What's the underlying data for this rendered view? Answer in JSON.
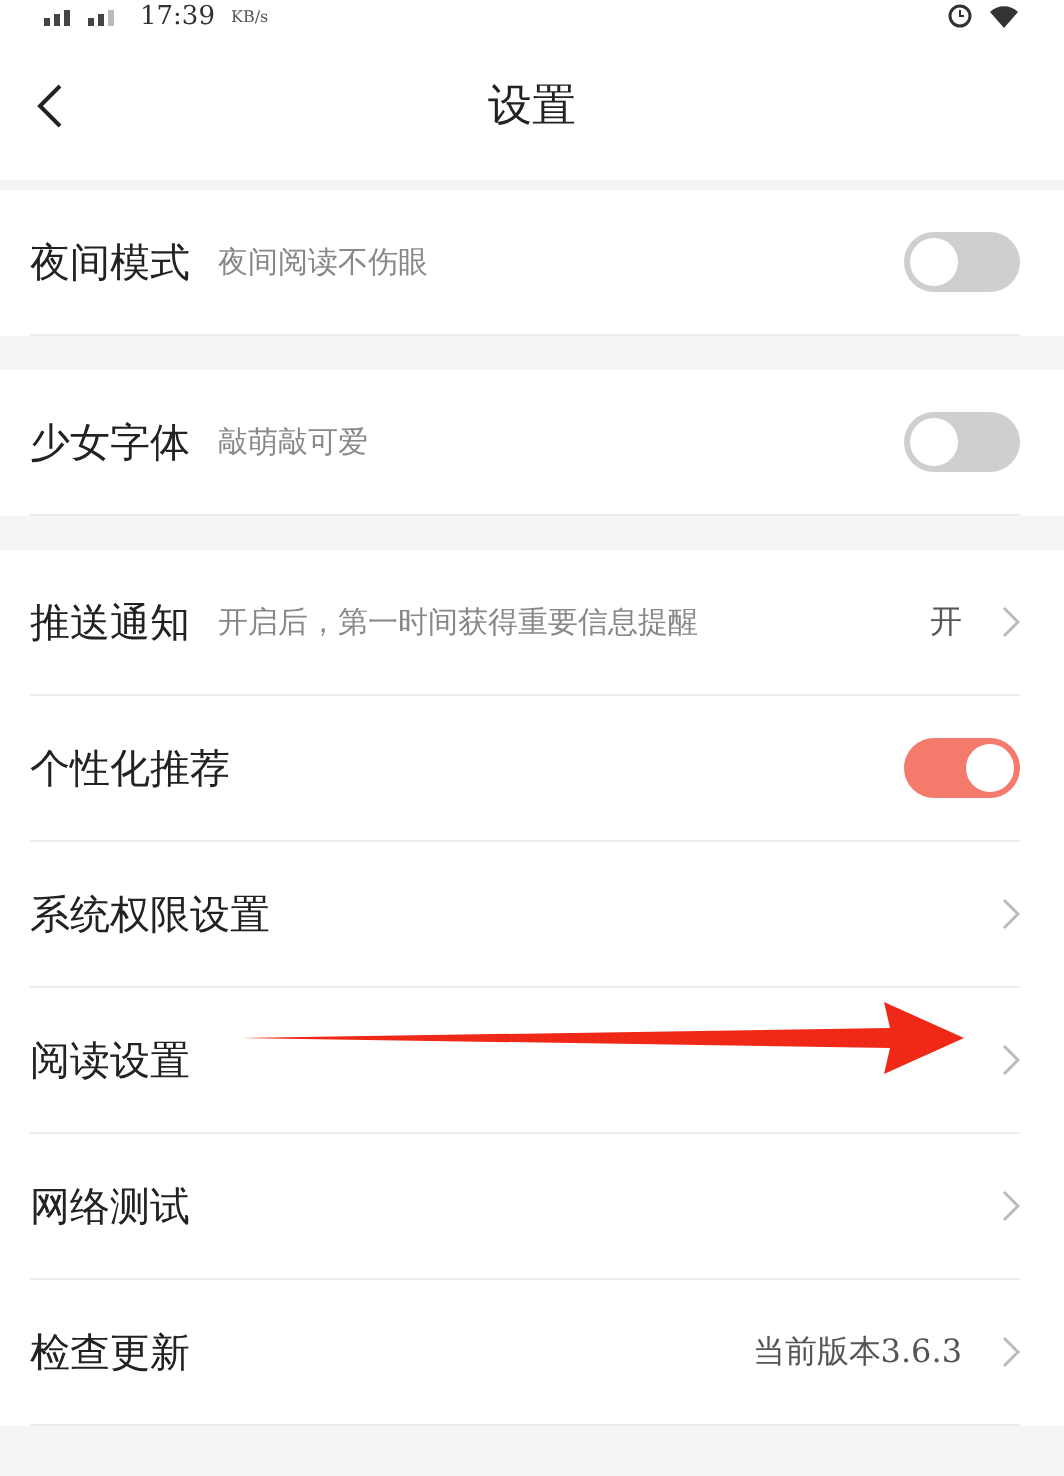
{
  "status_bar": {
    "time": "17:39",
    "speed_unit": "KB/s"
  },
  "header": {
    "title": "设置"
  },
  "groups": [
    {
      "items": [
        {
          "kind": "toggle",
          "label": "夜间模式",
          "subtitle": "夜间阅读不伤眼",
          "on": false
        }
      ]
    },
    {
      "items": [
        {
          "kind": "toggle",
          "label": "少女字体",
          "subtitle": "敲萌敲可爱",
          "on": false
        }
      ]
    },
    {
      "items": [
        {
          "kind": "link",
          "label": "推送通知",
          "subtitle": "开启后，第一时间获得重要信息提醒",
          "value": "开"
        },
        {
          "kind": "toggle",
          "label": "个性化推荐",
          "on": true
        },
        {
          "kind": "link",
          "label": "系统权限设置"
        },
        {
          "kind": "link",
          "label": "阅读设置"
        },
        {
          "kind": "link",
          "label": "网络测试"
        },
        {
          "kind": "link",
          "label": "检查更新",
          "value": "当前版本3.6.3"
        }
      ]
    }
  ]
}
